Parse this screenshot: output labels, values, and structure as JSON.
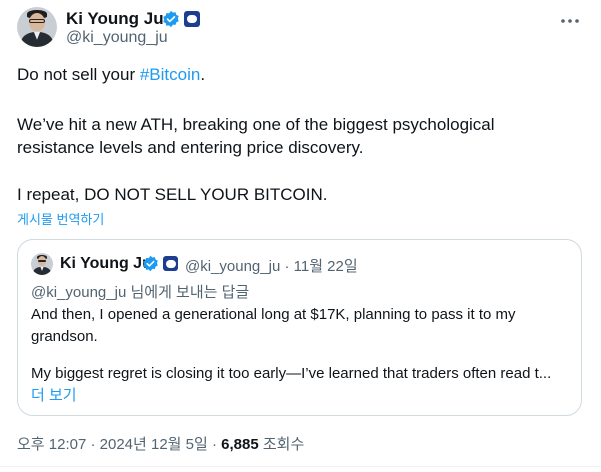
{
  "post": {
    "author_name": "Ki Young Ju",
    "author_handle": "@ki_young_ju",
    "more_icon": "more-horizontal-icon",
    "line1_prefix": "Do not sell your ",
    "line1_hashtag": "#Bitcoin",
    "line1_suffix": ".",
    "line2": "We’ve hit a new ATH, breaking one of the biggest psychological",
    "line3": "resistance levels and entering price discovery.",
    "line4": "I repeat, DO NOT SELL YOUR BITCOIN.",
    "translate_label": "게시물 번역하기"
  },
  "quoted": {
    "author_name": "Ki Young Ju",
    "author_handle": "@ki_young_ju",
    "separator": "·",
    "date": "11월 22일",
    "reply_handle": "@ki_young_ju",
    "reply_suffix": " 님에게 보내는 답글",
    "line1": "And then, I opened a generational long at $17K, planning to pass it to my",
    "line2": "grandson.",
    "line3": "My biggest regret is closing it too early—I’ve learned that traders often read t...",
    "show_more": "더 보기"
  },
  "footer": {
    "time": "오후 12:07",
    "sep1": "·",
    "date": "2024년 12월 5일",
    "sep2": "·",
    "views_count": "6,885",
    "views_label": "조회수"
  },
  "colors": {
    "accent": "#1d9bf0",
    "secondary_text": "#536471",
    "affiliate_badge": "#1d3d8f"
  }
}
